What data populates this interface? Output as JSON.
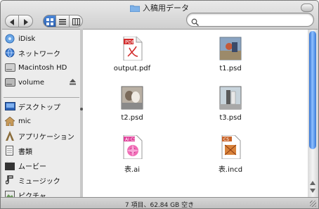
{
  "window": {
    "title": "入稿用データ"
  },
  "toolbar": {
    "back_icon": "back-arrow-icon",
    "forward_icon": "forward-arrow-icon",
    "views": [
      "icon-view",
      "list-view",
      "column-view"
    ],
    "search_placeholder": ""
  },
  "sidebar": {
    "devices": [
      {
        "label": "iDisk",
        "icon": "idisk-icon"
      },
      {
        "label": "ネットワーク",
        "icon": "network-icon"
      },
      {
        "label": "Macintosh HD",
        "icon": "harddisk-icon"
      },
      {
        "label": "volume",
        "icon": "volume-icon",
        "ejectable": true
      }
    ],
    "places": [
      {
        "label": "デスクトップ",
        "icon": "desktop-icon"
      },
      {
        "label": "mic",
        "icon": "home-icon"
      },
      {
        "label": "アプリケーション",
        "icon": "applications-icon"
      },
      {
        "label": "書類",
        "icon": "documents-icon"
      },
      {
        "label": "ムービー",
        "icon": "movies-icon"
      },
      {
        "label": "ミュージック",
        "icon": "music-icon"
      },
      {
        "label": "ピクチャ",
        "icon": "pictures-icon"
      }
    ]
  },
  "files": [
    {
      "name": "output.pdf",
      "icon": "pdf-file-icon"
    },
    {
      "name": "t1.psd",
      "icon": "psd-file-icon"
    },
    {
      "name": "t2.psd",
      "icon": "psd-file-icon"
    },
    {
      "name": "t3.psd",
      "icon": "psd-file-icon"
    },
    {
      "name": "表.ai",
      "icon": "ai-file-icon"
    },
    {
      "name": "表.incd",
      "icon": "indesign-file-icon"
    }
  ],
  "status": {
    "text": "7 項目、62.84 GB 空き"
  },
  "colors": {
    "accent": "#3a7bd8",
    "pdf_red": "#d22b2b",
    "ai_pink": "#e0429b",
    "indd_orange": "#c8642a"
  }
}
